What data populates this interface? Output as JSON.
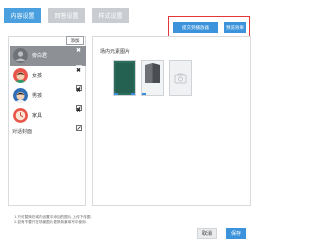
{
  "tabs": [
    {
      "label": "内容设置",
      "active": true
    },
    {
      "label": "回答设置",
      "active": false
    },
    {
      "label": "样式设置",
      "active": false
    }
  ],
  "toolbar": {
    "submit_label": "提交到播放器",
    "prev_label": "预览效果"
  },
  "character_list": {
    "add_label": "添加",
    "items": [
      {
        "label": "旁白君",
        "selected": true,
        "avatar_icon": "gray-avatar-icon"
      },
      {
        "label": "女孩",
        "selected": false,
        "avatar_icon": "girl-avatar-icon"
      },
      {
        "label": "男孩",
        "selected": false,
        "avatar_icon": "boy-avatar-icon"
      },
      {
        "label": "家具",
        "selected": false,
        "avatar_icon": "clock-avatar-icon"
      }
    ],
    "background_label": "对话封面"
  },
  "content": {
    "section_title": "场内元素图片"
  },
  "footer": {
    "note_line1": "1.只可替换在域内设置中添加的图片,上传下传图.",
    "note_line2": "2.如有不要只在场景图片更换背景填写中使用.",
    "cancel_label": "取消",
    "save_label": "保存"
  },
  "colors": {
    "accent": "#3d93db",
    "tab_active": "#4aa0df",
    "tab_inactive": "#c9cdd2",
    "highlight": "#e3373a",
    "selected_item": "#8d9196"
  }
}
